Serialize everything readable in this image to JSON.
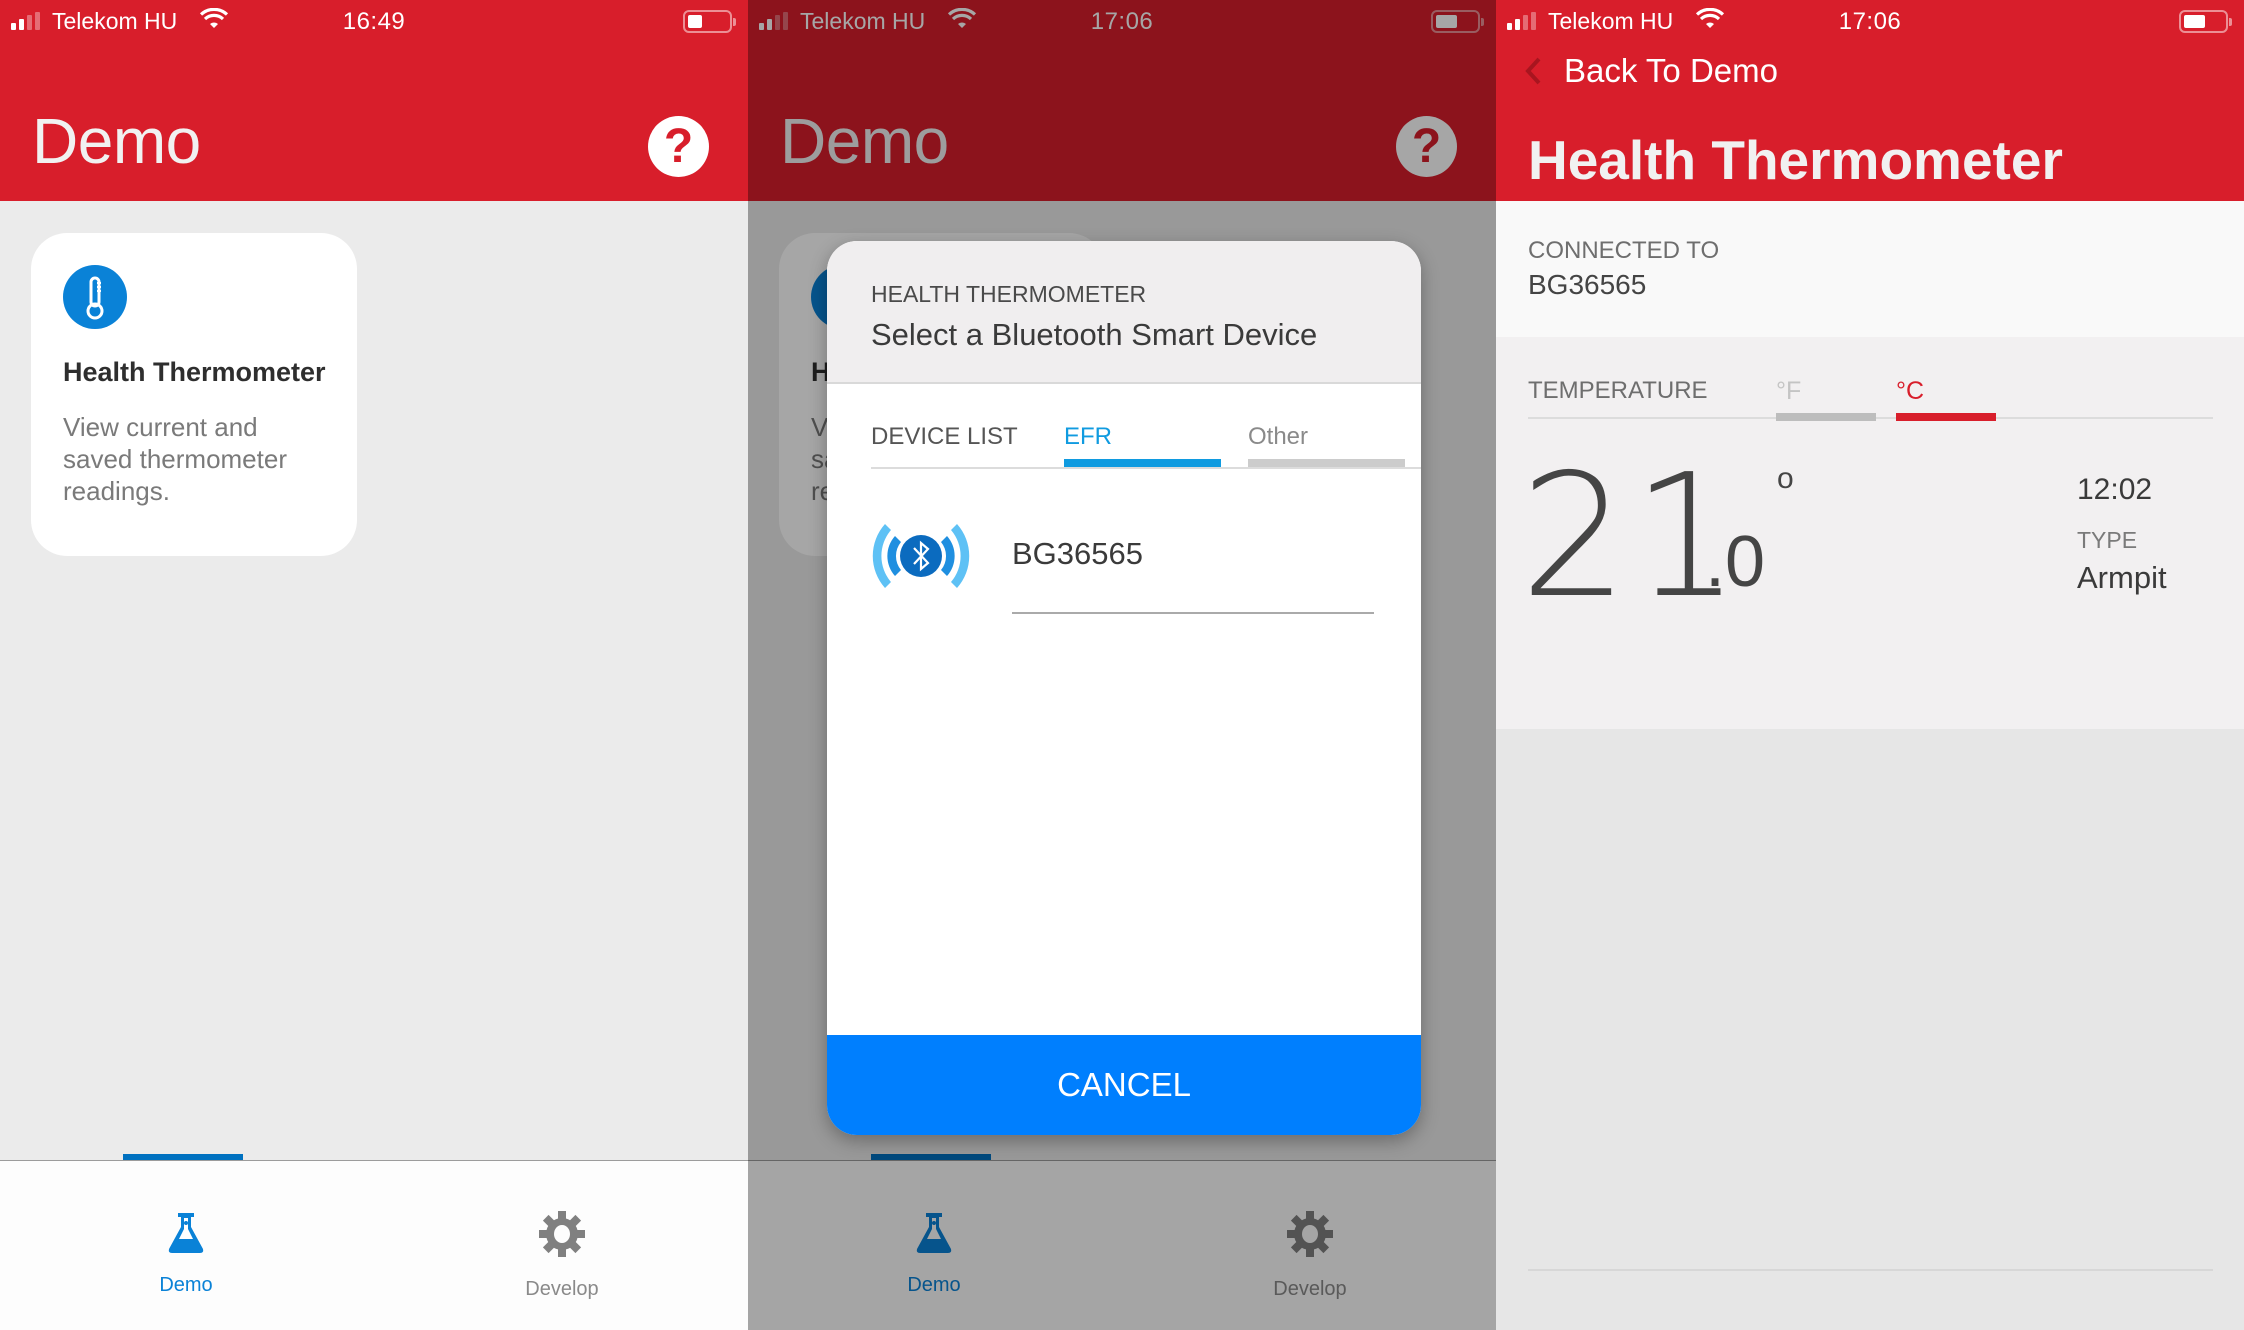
{
  "colors": {
    "brand_red": "#d81e2b",
    "accent_blue": "#0a82d7",
    "cancel_blue": "#007ffe",
    "tab_active_blue": "#109be0"
  },
  "screens": [
    {
      "status_bar": {
        "carrier": "Telekom HU",
        "time": "16:49",
        "signal_bars": 2,
        "signal_bars_total": 4,
        "battery_percent": 35
      },
      "header": {
        "title": "Demo",
        "help_icon": "question-circle-icon"
      },
      "demo_card": {
        "icon": "thermometer-icon",
        "title": "Health Thermometer",
        "description": "View current and saved thermometer readings."
      },
      "tab_bar": {
        "items": [
          {
            "label": "Demo",
            "icon": "flask-icon",
            "active": true
          },
          {
            "label": "Develop",
            "icon": "gear-icon",
            "active": false
          }
        ]
      }
    },
    {
      "status_bar": {
        "carrier": "Telekom HU",
        "time": "17:06",
        "signal_bars": 2,
        "signal_bars_total": 4,
        "battery_percent": 55
      },
      "header": {
        "title": "Demo",
        "help_icon": "question-circle-icon"
      },
      "demo_card": {
        "icon": "thermometer-icon",
        "title": "Health Thermometer",
        "description": "View current and saved thermometer readings."
      },
      "dialog": {
        "overline": "HEALTH THERMOMETER",
        "title": "Select a Bluetooth Smart Device",
        "tabs_label": "DEVICE LIST",
        "tabs": [
          {
            "label": "EFR",
            "active": true
          },
          {
            "label": "Other",
            "active": false
          }
        ],
        "devices": [
          {
            "name": "BG36565",
            "icon": "bluetooth-signal-icon"
          }
        ],
        "cancel_label": "CANCEL"
      },
      "tab_bar": {
        "items": [
          {
            "label": "Demo",
            "icon": "flask-icon",
            "active": true
          },
          {
            "label": "Develop",
            "icon": "gear-icon",
            "active": false
          }
        ]
      }
    },
    {
      "status_bar": {
        "carrier": "Telekom HU",
        "time": "17:06",
        "signal_bars": 2,
        "signal_bars_total": 4,
        "battery_percent": 55
      },
      "back_label": "Back To Demo",
      "title": "Health Thermometer",
      "connection": {
        "label": "CONNECTED TO",
        "device": "BG36565"
      },
      "temperature": {
        "label": "TEMPERATURE",
        "units": [
          {
            "label": "°F",
            "active": false
          },
          {
            "label": "°C",
            "active": true
          }
        ],
        "integer": "21",
        "decimal": ".0",
        "degree_symbol": "o",
        "time": "12:02",
        "type_label": "TYPE",
        "type_value": "Armpit"
      }
    }
  ]
}
